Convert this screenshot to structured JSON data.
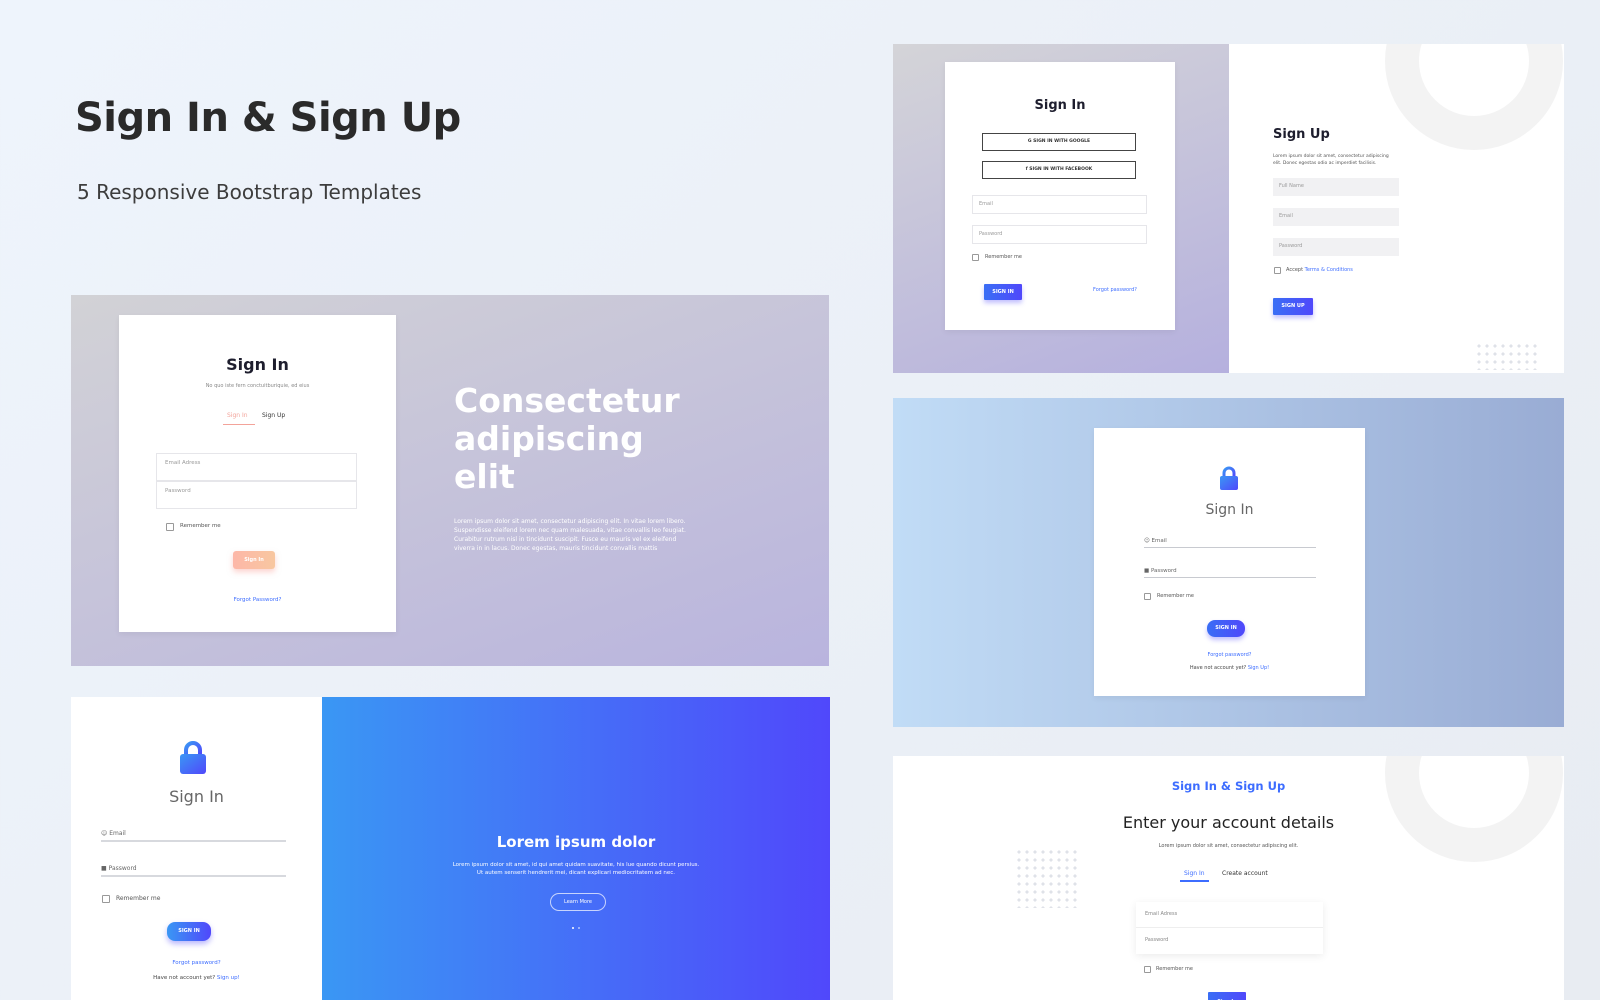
{
  "hero": {
    "title": "Sign In & Sign Up",
    "subtitle": "5 Responsive Bootstrap Templates"
  },
  "colors": {
    "accent_blue": "#3d6dff",
    "gradient_purple": "#5048fb",
    "gradient_blue": "#3a97f4",
    "button_orange": "#f9a8a0"
  },
  "panel1": {
    "title": "Sign In",
    "subtitle": "No quo iste fern conctuitburiquie, ed eius",
    "tabs": [
      "Sign In",
      "Sign Up"
    ],
    "email_placeholder": "Email Adress",
    "password_placeholder": "Password",
    "remember": "Remember me",
    "button": "Sign In",
    "forgot": "Forgot Password?",
    "headline_1": "Consectetur",
    "headline_2": "adipiscing",
    "headline_3": "elit",
    "paragraph_1": "Lorem ipsum dolor sit amet, consectetur adipiscing elit. In vitae lorem libero.",
    "paragraph_2": "Suspendisse eleifend lorem nec quam malesuada, vitae convallis leo feugiat.",
    "paragraph_3": "Curabitur rutrum nisl in tincidunt suscipit. Fusce eu mauris vel ex eleifend",
    "paragraph_4": "viverra in in lacus. Donec egestas, mauris tincidunt convallis mattis"
  },
  "panel2": {
    "title": "Sign In",
    "email_label": "Email",
    "password_label": "Password",
    "remember": "Remember me",
    "button": "SIGN IN",
    "forgot": "Forgot password?",
    "no_account": "Have not account yet?",
    "sign_up_link": "Sign up!",
    "right_heading": "Lorem ipsum dolor",
    "right_paragraph_1": "Lorem ipsum dolor sit amet, id qui amet quidam suavitate, his lue quando dicunt persius.",
    "right_paragraph_2": "Ut autem senserit hendrerit mei, dicant explicari mediocritatem ad nec.",
    "learn_more": "Learn More"
  },
  "panel3": {
    "signin_title": "Sign In",
    "google_button": "SIGN IN WITH GOOGLE",
    "facebook_button": "SIGN IN WITH FACEBOOK",
    "email_placeholder": "Email",
    "password_placeholder": "Password",
    "remember": "Remember me",
    "signin_button": "SIGN IN",
    "forgot": "Forgot password?",
    "signup_title": "Sign Up",
    "signup_desc_1": "Lorem ipsum dolor sit amet, consectetur adipiscing",
    "signup_desc_2": "elit. Donec egestas odio ac imperdiet facilisis.",
    "fullname_placeholder": "Full Name",
    "signup_email_placeholder": "Email",
    "signup_password_placeholder": "Password",
    "accept": "Accept",
    "terms": "Terms & Conditions",
    "signup_button": "SIGN UP"
  },
  "panel4": {
    "title": "Sign In",
    "email_label": "Email",
    "password_label": "Password",
    "remember": "Remember me",
    "button": "SIGN IN",
    "forgot": "Forgot password?",
    "no_account": "Have not account yet?",
    "sign_up_link": "Sign Up!"
  },
  "panel5": {
    "brand": "Sign In & Sign Up",
    "heading": "Enter your account details",
    "desc": "Lorem ipsum dolor sit amet, consectetur adipiscing elit.",
    "tabs": [
      "Sign In",
      "Create account"
    ],
    "email_placeholder": "Email Adress",
    "password_placeholder": "Password",
    "remember": "Remember me",
    "button": "Sign In"
  }
}
